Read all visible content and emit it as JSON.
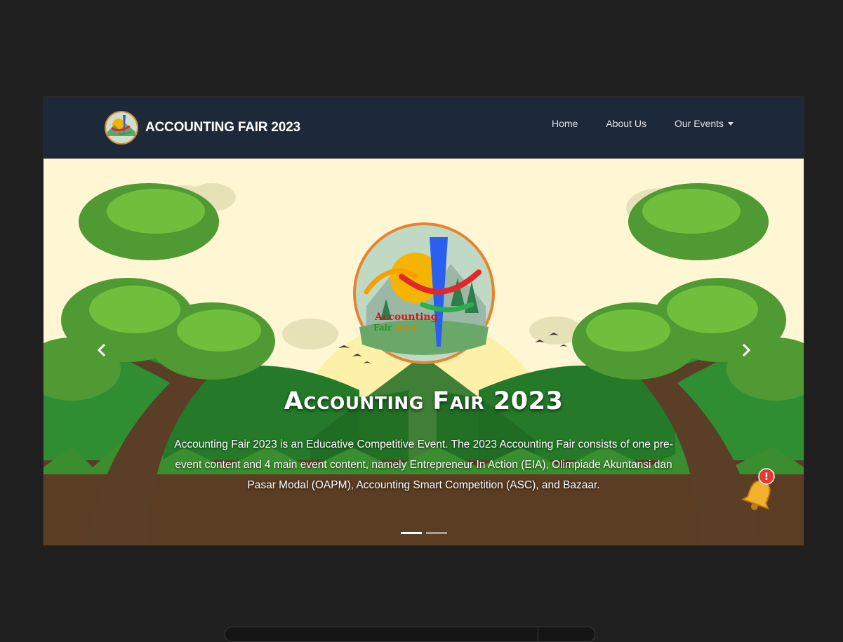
{
  "navbar": {
    "brand_text": "ACCOUNTING FAIR 2023",
    "links": [
      {
        "label": "Home"
      },
      {
        "label": "About Us"
      },
      {
        "label": "Our Events",
        "dropdown": true
      }
    ]
  },
  "hero": {
    "logo_text_line1": "Accounting",
    "logo_text_line2": "Fair",
    "logo_text_year": "2023",
    "title": "Accounting Fair 2023",
    "description": "Accounting Fair 2023 is an Educative Competitive Event. The 2023 Accounting Fair consists of one pre-event content and 4 main event content, namely Entrepreneur In Action (EIA), Olimpiade Akuntansi dan Pasar Modal (OAPM), Accounting Smart Competition (ASC), and Bazaar.",
    "prev_icon": "chevron-left-icon",
    "next_icon": "chevron-right-icon",
    "slides_total": 2,
    "active_slide": 1
  },
  "notification": {
    "icon": "bell-icon",
    "badge": "!"
  },
  "colors": {
    "page_bg": "#1f1f1f",
    "navbar_bg": "#1c2938",
    "sky": "#fff6d4",
    "hill_dark": "#2a7a2c",
    "ground": "#5a3d22",
    "logo_border": "#e9822e",
    "badge": "#e53935"
  }
}
